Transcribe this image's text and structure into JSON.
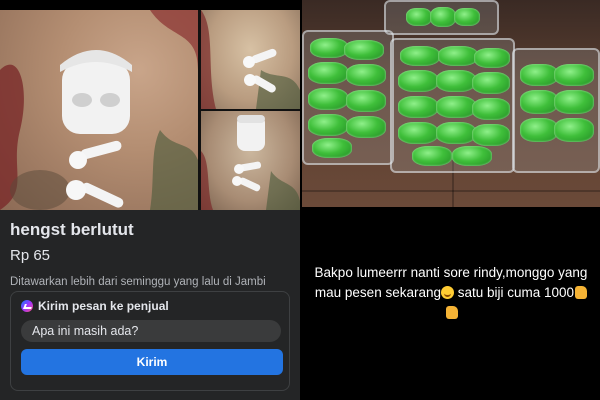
{
  "listing": {
    "title": "hengst berlutut",
    "price": "Rp 65",
    "meta": "Ditawarkan lebih dari seminggu yang lalu di Jambi",
    "message_card": {
      "header": "Kirim pesan ke penjual",
      "input_value": "Apa ini masih ada?",
      "send_label": "Kirim"
    }
  },
  "post": {
    "caption_text_1": "Bakpo lumeerrr nanti sore rindy,monggo yang mau pesen sekarang",
    "caption_text_2": " satu biji cuma 1000",
    "emoji_1": "smiling-face",
    "emoji_2": "thumbs-up",
    "emoji_3": "thumbs-up"
  },
  "colors": {
    "panel_bg": "#242526",
    "accent_button": "#2374e1",
    "input_bg": "#3a3b3c",
    "text_primary": "#e4e6eb",
    "text_secondary": "#b0b3b8",
    "package_green": "#3fbf3a"
  }
}
